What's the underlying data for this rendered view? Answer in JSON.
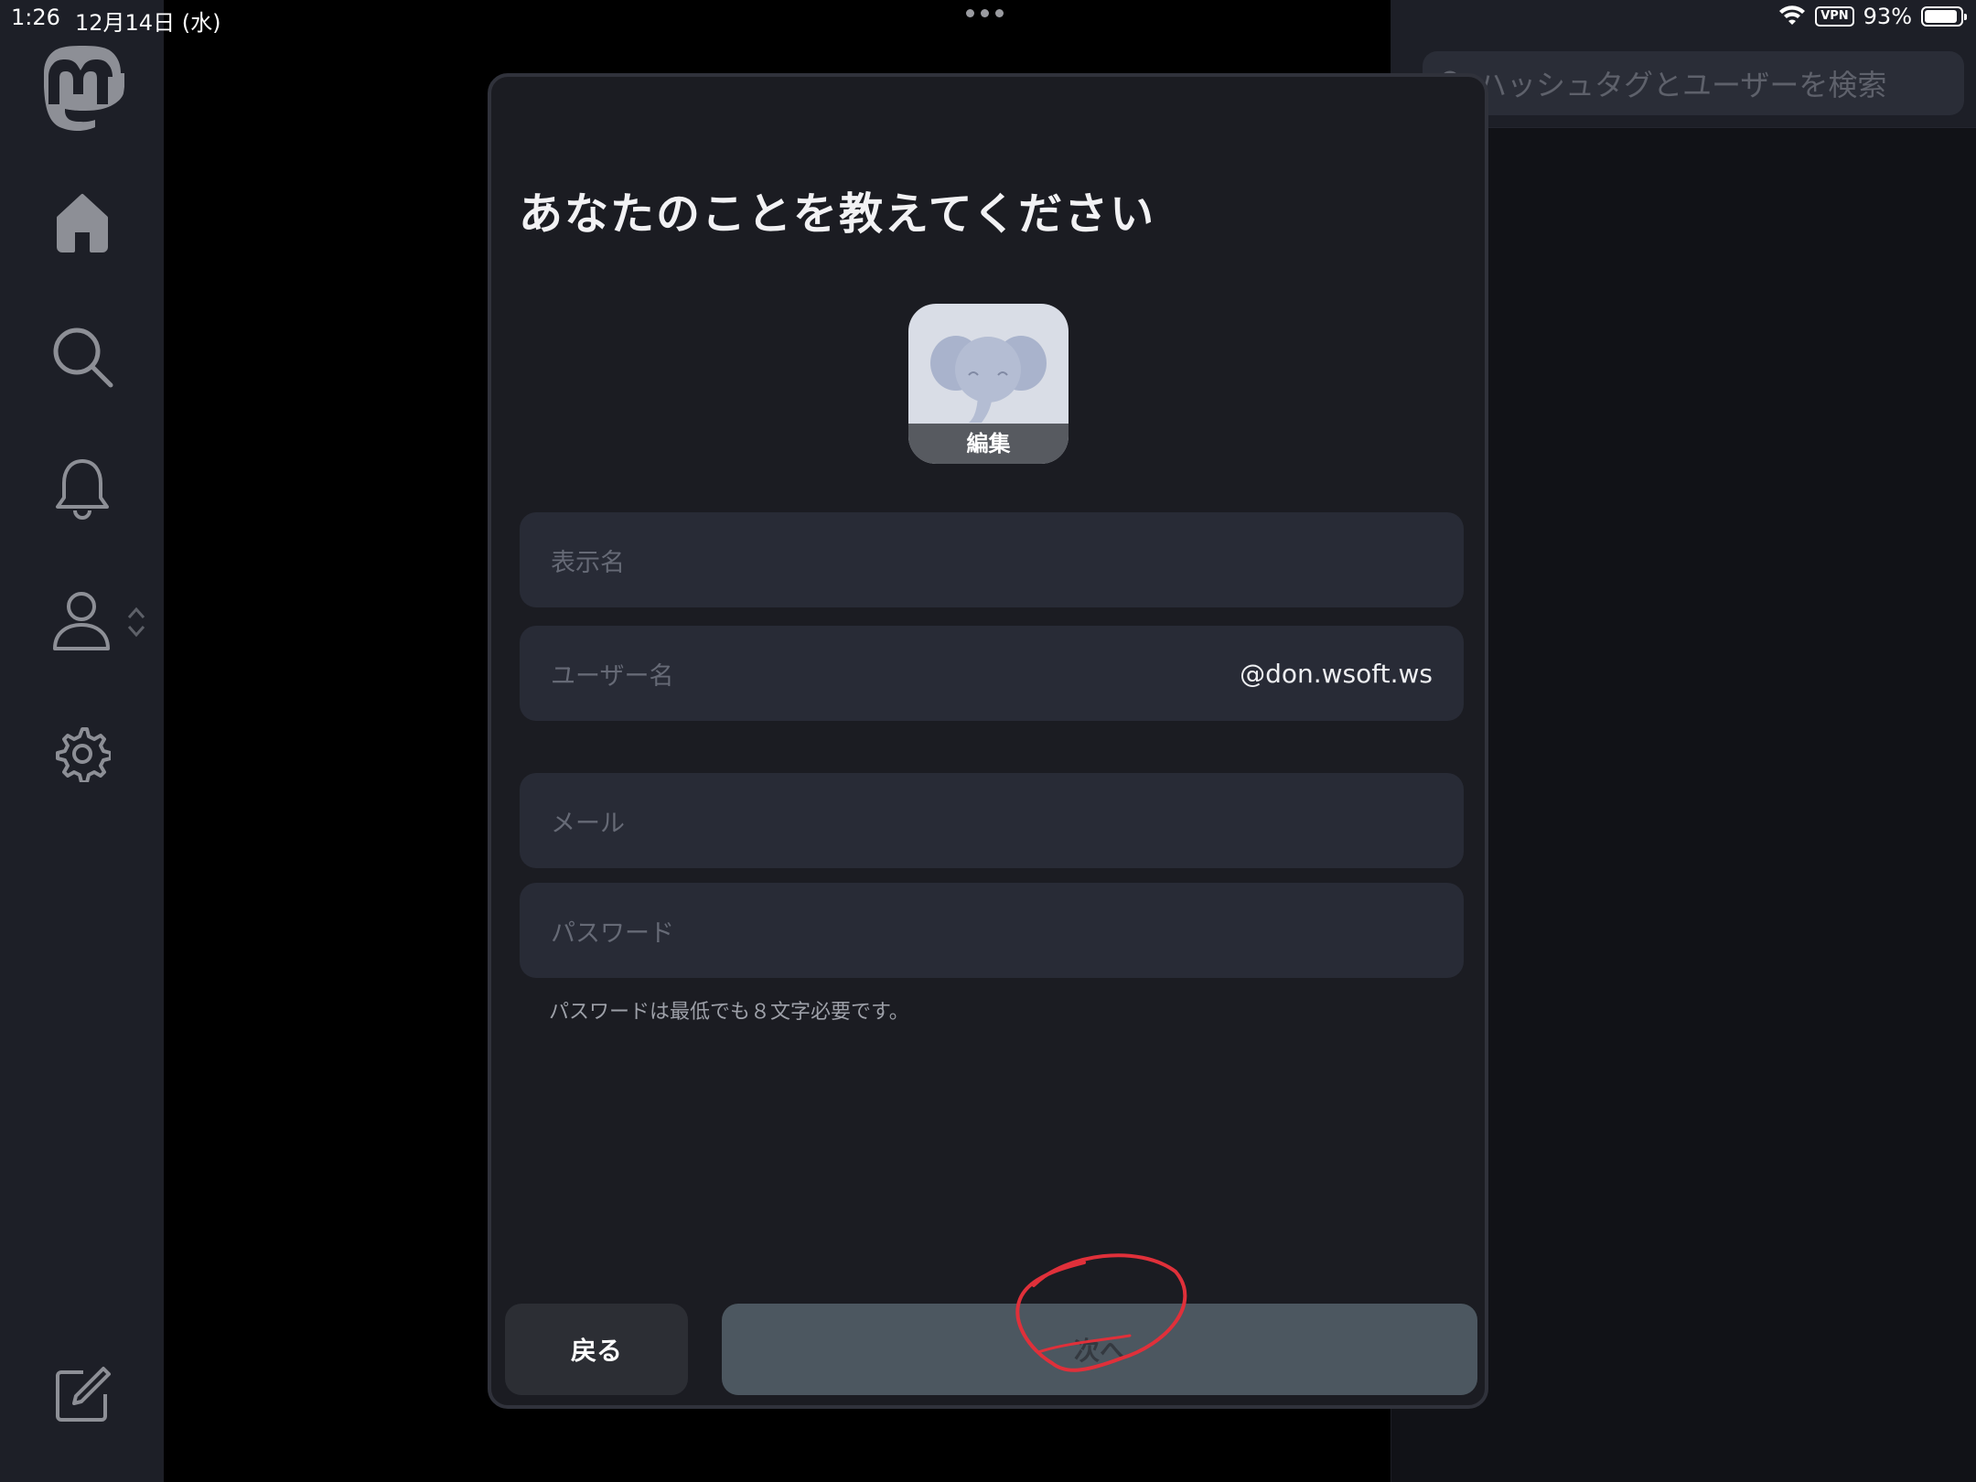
{
  "status_bar": {
    "time": "1:26",
    "date": "12月14日 (水)",
    "vpn": "VPN",
    "battery": "93%",
    "battery_level": 0.93
  },
  "sidebar": {
    "items": [
      {
        "icon": "mastodon-logo-icon"
      },
      {
        "icon": "home-icon"
      },
      {
        "icon": "search-icon"
      },
      {
        "icon": "bell-icon"
      },
      {
        "icon": "user-icon"
      },
      {
        "icon": "gear-icon"
      },
      {
        "icon": "compose-icon"
      }
    ]
  },
  "right_panel": {
    "search_placeholder": "ハッシュタグとユーザーを検索"
  },
  "modal": {
    "title": "あなたのことを教えてください",
    "avatar_edit_label": "編集",
    "fields": {
      "display_name_placeholder": "表示名",
      "username_placeholder": "ユーザー名",
      "username_domain": "@don.wsoft.ws",
      "email_placeholder": "メール",
      "password_placeholder": "パスワード"
    },
    "password_hint": "パスワードは最低でも８文字必要です。",
    "back_button": "戻る",
    "next_button": "次へ"
  },
  "colors": {
    "background": "#000000",
    "sidebar": "#1d1f27",
    "modal": "#1b1c22",
    "field": "#282b36",
    "next_button": "#4c5760",
    "annotation": "#e0303a"
  }
}
